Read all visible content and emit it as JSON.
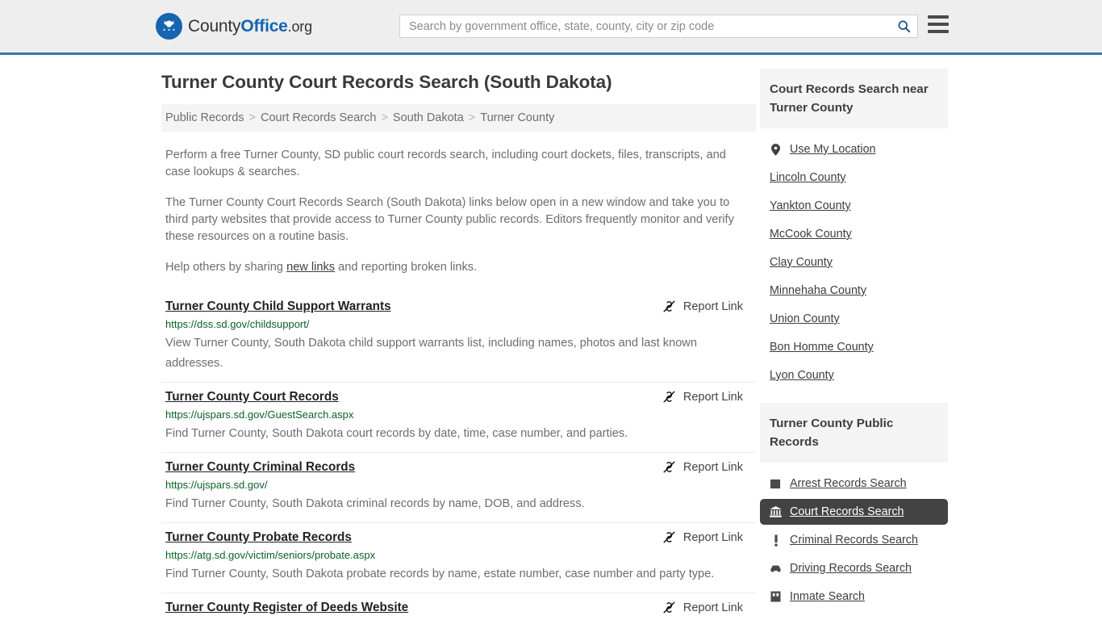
{
  "header": {
    "brand": {
      "part1": "County",
      "part2": "Office",
      "part3": ".org",
      "logo_icon": "eagle-seal-icon"
    },
    "search": {
      "placeholder": "Search by government office, state, county, city or zip code",
      "value": "",
      "search_icon": "search-icon"
    },
    "menu_icon": "hamburger-menu-icon",
    "accent_color": "#3a76a8"
  },
  "main": {
    "title": "Turner County Court Records Search (South Dakota)",
    "breadcrumb": [
      {
        "label": "Public Records"
      },
      {
        "label": "Court Records Search"
      },
      {
        "label": "South Dakota"
      },
      {
        "label": "Turner County"
      }
    ],
    "breadcrumb_separator": ">",
    "intro": {
      "p1": "Perform a free Turner County, SD public court records search, including court dockets, files, transcripts, and case lookups & searches.",
      "p2": "The Turner County Court Records Search (South Dakota) links below open in a new window and take you to third party websites that provide access to Turner County public records. Editors frequently monitor and verify these resources on a routine basis.",
      "p3_before": "Help others by sharing ",
      "p3_link": "new links",
      "p3_after": " and reporting broken links."
    },
    "report_link_label": "Report Link",
    "report_link_icon": "broken-link-icon",
    "results": [
      {
        "title": "Turner County Child Support Warrants",
        "url": "https://dss.sd.gov/childsupport/",
        "desc": "View Turner County, South Dakota child support warrants list, including names, photos and last known addresses."
      },
      {
        "title": "Turner County Court Records",
        "url": "https://ujspars.sd.gov/GuestSearch.aspx",
        "desc": "Find Turner County, South Dakota court records by date, time, case number, and parties."
      },
      {
        "title": "Turner County Criminal Records",
        "url": "https://ujspars.sd.gov/",
        "desc": "Find Turner County, South Dakota criminal records by name, DOB, and address."
      },
      {
        "title": "Turner County Probate Records",
        "url": "https://atg.sd.gov/victim/seniors/probate.aspx",
        "desc": "Find Turner County, South Dakota probate records by name, estate number, case number and party type."
      },
      {
        "title": "Turner County Register of Deeds Website",
        "url": "",
        "desc": ""
      }
    ]
  },
  "sidebar": {
    "nearby": {
      "heading": "Court Records Search near Turner County",
      "items": [
        {
          "label": "Use My Location",
          "icon": "map-pin-icon"
        },
        {
          "label": "Lincoln County",
          "icon": ""
        },
        {
          "label": "Yankton County",
          "icon": ""
        },
        {
          "label": "McCook County",
          "icon": ""
        },
        {
          "label": "Clay County",
          "icon": ""
        },
        {
          "label": "Minnehaha County",
          "icon": ""
        },
        {
          "label": "Union County",
          "icon": ""
        },
        {
          "label": "Bon Homme County",
          "icon": ""
        },
        {
          "label": "Lyon County",
          "icon": ""
        }
      ]
    },
    "public_records": {
      "heading": "Turner County Public Records",
      "items": [
        {
          "label": "Arrest Records Search",
          "icon": "square-icon",
          "active": false
        },
        {
          "label": "Court Records Search",
          "icon": "courthouse-icon",
          "active": true
        },
        {
          "label": "Criminal Records Search",
          "icon": "exclamation-icon",
          "active": false
        },
        {
          "label": "Driving Records Search",
          "icon": "car-icon",
          "active": false
        },
        {
          "label": "Inmate Search",
          "icon": "inmate-icon",
          "active": false
        }
      ]
    }
  }
}
